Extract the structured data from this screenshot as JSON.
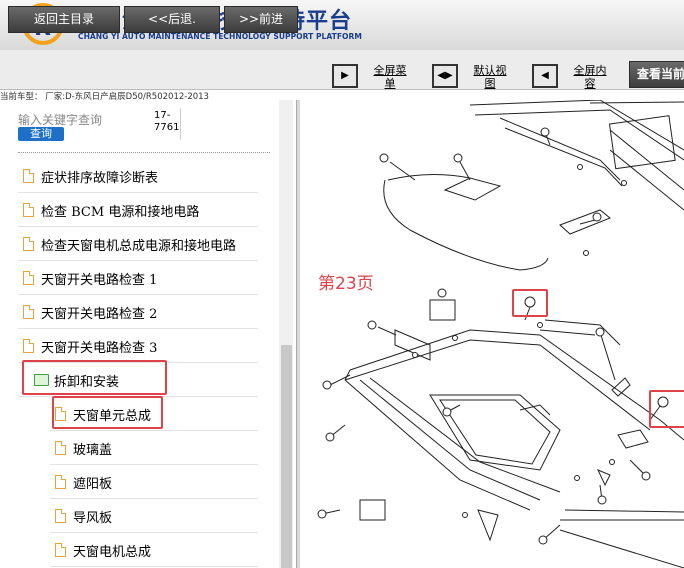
{
  "app": {
    "title_cn": "畅易汽车维修技术支持平台",
    "title_en": "CHANG YI AUTO MAINTENANCE TECHNOLOGY SUPPORT PLATFORM"
  },
  "toolbar": {
    "back_main": "返回主目录",
    "back": "<<后退.",
    "forward": ">>前进",
    "fullscreen_menu": "全屏菜单",
    "default_view": "默认视图",
    "fullscreen_content": "全屏内容",
    "view_current": "查看当前"
  },
  "current_model": "当前车型：  厂家:D-东风日产启辰D50/R502012-2013",
  "search": {
    "placeholder": "输入关键字查询",
    "button": "查询",
    "code": "17-7761"
  },
  "tree": {
    "items": [
      "症状排序故障诊断表",
      "检查 BCM 电源和接地电路",
      "检查天窗电机总成电源和接地电路",
      "天窗开关电路检查 1",
      "天窗开关电路检查 2",
      "天窗开关电路检查 3"
    ],
    "folder": "拆卸和安装",
    "children": [
      "天窗单元总成",
      "玻璃盖",
      "遮阳板",
      "导风板",
      "天窗电机总成"
    ]
  },
  "content": {
    "page_label": "第23页"
  },
  "colors": {
    "brand_blue": "#1a3d8f",
    "highlight_red": "#e0424a",
    "query_blue": "#1d6fc8"
  }
}
